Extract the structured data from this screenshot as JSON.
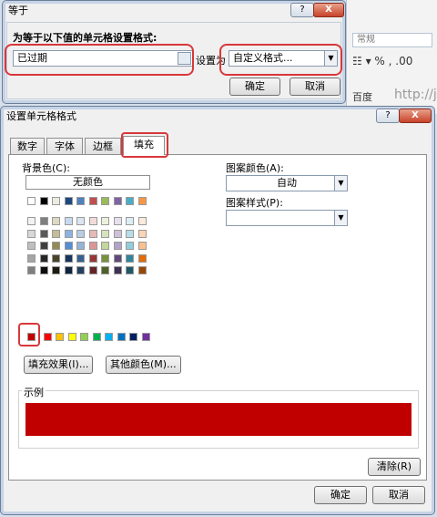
{
  "background": {
    "format_box": "常规",
    "baidu_label": "百度",
    "url_fragment": "http://jin"
  },
  "dialog1": {
    "title": "等于",
    "help": "?",
    "close": "X",
    "prompt": "为等于以下值的单元格设置格式:",
    "value": "已过期",
    "set_as": "设置为",
    "format_choice": "自定义格式...",
    "ok": "确定",
    "cancel": "取消"
  },
  "dialog2": {
    "title": "设置单元格格式",
    "help": "?",
    "close": "X",
    "tabs": [
      "数字",
      "字体",
      "边框",
      "填充"
    ],
    "active_tab": "填充",
    "bg_color_label": "背景色(C):",
    "no_color": "无颜色",
    "fill_effects": "填充效果(I)...",
    "more_colors": "其他颜色(M)...",
    "pattern_color_label": "图案颜色(A):",
    "pattern_color_value": "自动",
    "pattern_style_label": "图案样式(P):",
    "pattern_style_value": "",
    "sample_label": "示例",
    "clear": "清除(R)",
    "ok": "确定",
    "cancel": "取消",
    "sample_color": "#c00000",
    "selected_swatch": "#c00000"
  },
  "palette": {
    "theme_top": [
      "#ffffff",
      "#000000",
      "#eeece1",
      "#1f497d",
      "#4f81bd",
      "#c0504d",
      "#9bbb59",
      "#8064a2",
      "#4bacc6",
      "#f79646"
    ],
    "shades": [
      [
        "#f2f2f2",
        "#7f7f7f",
        "#ddd9c3",
        "#c6d9f0",
        "#dbe5f1",
        "#f2dcdb",
        "#ebf1dd",
        "#e5e0ec",
        "#dbeef3",
        "#fdeada"
      ],
      [
        "#d8d8d8",
        "#595959",
        "#c4bd97",
        "#8db3e2",
        "#b8cce4",
        "#e5b9b7",
        "#d7e3bc",
        "#ccc1d9",
        "#b7dde8",
        "#fbd5b5"
      ],
      [
        "#bfbfbf",
        "#3f3f3f",
        "#938953",
        "#548dd4",
        "#95b3d7",
        "#d99694",
        "#c3d69b",
        "#b2a2c7",
        "#92cddc",
        "#fac08f"
      ],
      [
        "#a5a5a5",
        "#262626",
        "#494429",
        "#17365d",
        "#366092",
        "#953734",
        "#76923c",
        "#5f497a",
        "#31859b",
        "#e36c09"
      ],
      [
        "#7f7f7f",
        "#0c0c0c",
        "#1d1b10",
        "#0f243e",
        "#244061",
        "#632423",
        "#4f6128",
        "#3f3151",
        "#205867",
        "#974806"
      ]
    ],
    "standard": [
      "#c00000",
      "#ff0000",
      "#ffc000",
      "#ffff00",
      "#92d050",
      "#00b050",
      "#00b0f0",
      "#0070c0",
      "#002060",
      "#7030a0"
    ]
  }
}
